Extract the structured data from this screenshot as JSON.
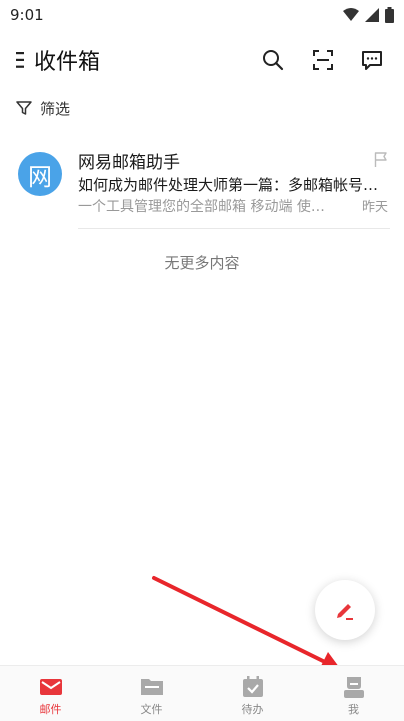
{
  "status_bar": {
    "time": "9:01"
  },
  "header": {
    "title": "收件箱"
  },
  "filter": {
    "label": "筛选"
  },
  "mail_items": [
    {
      "avatar_text": "网",
      "sender": "网易邮箱助手",
      "subject": "如何成为邮件处理大师第一篇：多邮箱帐号…",
      "preview": "一个工具管理您的全部邮箱 移动端 使…",
      "date": "昨天"
    }
  ],
  "no_more_text": "无更多内容",
  "bottom_nav": {
    "items": [
      {
        "label": "邮件",
        "icon": "mail-icon",
        "active": true
      },
      {
        "label": "文件",
        "icon": "folder-icon",
        "active": false
      },
      {
        "label": "待办",
        "icon": "calendar-check-icon",
        "active": false
      },
      {
        "label": "我",
        "icon": "profile-icon",
        "active": false
      }
    ]
  },
  "colors": {
    "accent": "#e8363b",
    "avatar_bg": "#4aa3e8",
    "annotation_arrow": "#e8262b"
  }
}
